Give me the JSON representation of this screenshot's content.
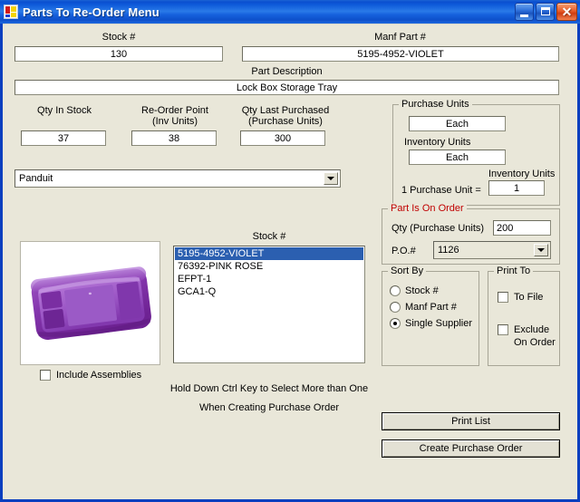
{
  "window": {
    "title": "Parts To Re-Order Menu",
    "app_icon": "vb-form-icon",
    "minimize_label": "Minimize",
    "maximize_label": "Maximize",
    "close_label": "✕",
    "titlebar_color": "#1B64D4",
    "form_background": "#E9E7D9"
  },
  "header": {
    "stock_label": "Stock #",
    "stock_value": "130",
    "manf_label": "Manf Part #",
    "manf_value": "5195-4952-VIOLET",
    "description_label": "Part Description",
    "description_value": "Lock Box Storage Tray"
  },
  "quantities": {
    "qty_in_stock_label": "Qty In Stock",
    "qty_in_stock_value": "37",
    "reorder_point_label_1": "Re-Order Point",
    "reorder_point_label_2": "(Inv Units)",
    "reorder_point_value": "38",
    "qty_last_purchased_label_1": "Qty Last Purchased",
    "qty_last_purchased_label_2": "(Purchase Units)",
    "qty_last_purchased_value": "300"
  },
  "supplier": {
    "selected": "Panduit"
  },
  "purchase_units": {
    "group_title": "Purchase Units",
    "purchase_units_value": "Each",
    "inventory_units_label": "Inventory Units",
    "inventory_units_value": "Each",
    "conversion_label": "1 Purchase Unit =",
    "conversion_units_label": "Inventory  Units",
    "conversion_value": "1"
  },
  "on_order": {
    "group_title": "Part Is On Order",
    "group_title_color": "#C00000",
    "qty_label": "Qty (Purchase Units)",
    "qty_value": "200",
    "po_label": "P.O.#",
    "po_value": "1126"
  },
  "sort_by": {
    "group_title": "Sort By",
    "options": [
      {
        "label": "Stock #",
        "checked": false
      },
      {
        "label": "Manf Part #",
        "checked": false
      },
      {
        "label": "Single Supplier",
        "checked": true
      }
    ]
  },
  "print_to": {
    "group_title": "Print To",
    "to_file_label": "To File",
    "to_file_checked": false,
    "exclude_label_1": "Exclude",
    "exclude_label_2": "On Order",
    "exclude_checked": false
  },
  "stock_list": {
    "header_label": "Stock #",
    "items": [
      {
        "label": "5195-4952-VIOLET",
        "selected": true
      },
      {
        "label": "76392-PINK ROSE",
        "selected": false
      },
      {
        "label": "EFPT-1",
        "selected": false
      },
      {
        "label": "GCA1-Q",
        "selected": false
      }
    ],
    "hint_line_1": "Hold Down Ctrl Key to Select More than One",
    "hint_line_2": "When Creating Purchase Order",
    "selection_color": "#2B5FB0"
  },
  "picture": {
    "alt": "purple-storage-tray-photo"
  },
  "include_assemblies": {
    "label": "Include Assemblies",
    "checked": false
  },
  "actions": {
    "print_list_label": "Print List",
    "create_po_label": "Create Purchase Order"
  }
}
